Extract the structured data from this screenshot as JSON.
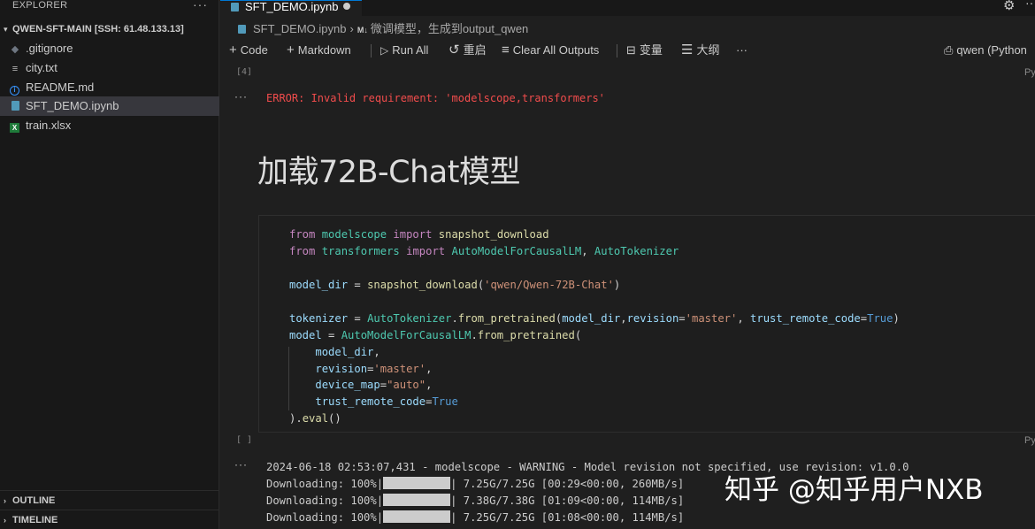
{
  "explorer": {
    "title": "EXPLORER",
    "more": "···",
    "folder": "QWEN-SFT-MAIN [SSH: 61.48.133.13]",
    "files": [
      {
        "name": ".gitignore",
        "icon": "git-icon"
      },
      {
        "name": "city.txt",
        "icon": "text-file-icon"
      },
      {
        "name": "README.md",
        "icon": "info-icon"
      },
      {
        "name": "SFT_DEMO.ipynb",
        "icon": "notebook-icon",
        "selected": true
      },
      {
        "name": "train.xlsx",
        "icon": "excel-icon"
      }
    ],
    "outline": "OUTLINE",
    "timeline": "TIMELINE"
  },
  "tab": {
    "label": "SFT_DEMO.ipynb"
  },
  "breadcrumb": {
    "file": "SFT_DEMO.ipynb",
    "md_badge": "M↓",
    "section": "微调模型，生成到output_qwen"
  },
  "toolbar": {
    "code": "Code",
    "markdown": "Markdown",
    "run_all": "Run All",
    "restart": "重启",
    "clear_outputs": "Clear All Outputs",
    "variables": "变量",
    "outline": "大纲",
    "more": "···",
    "kernel": "qwen (Python"
  },
  "cells": {
    "prev_exec_count": "[4]",
    "prev_lang": "Py",
    "error_text": "ERROR: Invalid requirement: 'modelscope,transformers'",
    "markdown_heading": "加载72B-Chat模型",
    "code_exec_count": "[ ]",
    "code_lang": "Py",
    "output_lines": [
      "2024-06-18 02:53:07,431 - modelscope - WARNING - Model revision not specified, use revision: v1.0.0",
      {
        "prefix": "Downloading: 100%|",
        "suffix": "| 7.25G/7.25G [00:29<00:00, 260MB/s]"
      },
      {
        "prefix": "Downloading: 100%|",
        "suffix": "| 7.38G/7.38G [01:09<00:00, 114MB/s]"
      },
      {
        "prefix": "Downloading: 100%|",
        "suffix": "| 7.25G/7.25G [01:08<00:00, 114MB/s]"
      }
    ]
  },
  "watermark": "知乎 @知乎用户NXB",
  "colors": {
    "accent": "#0078d4",
    "error": "#f14c4c",
    "selection": "#37373d"
  }
}
